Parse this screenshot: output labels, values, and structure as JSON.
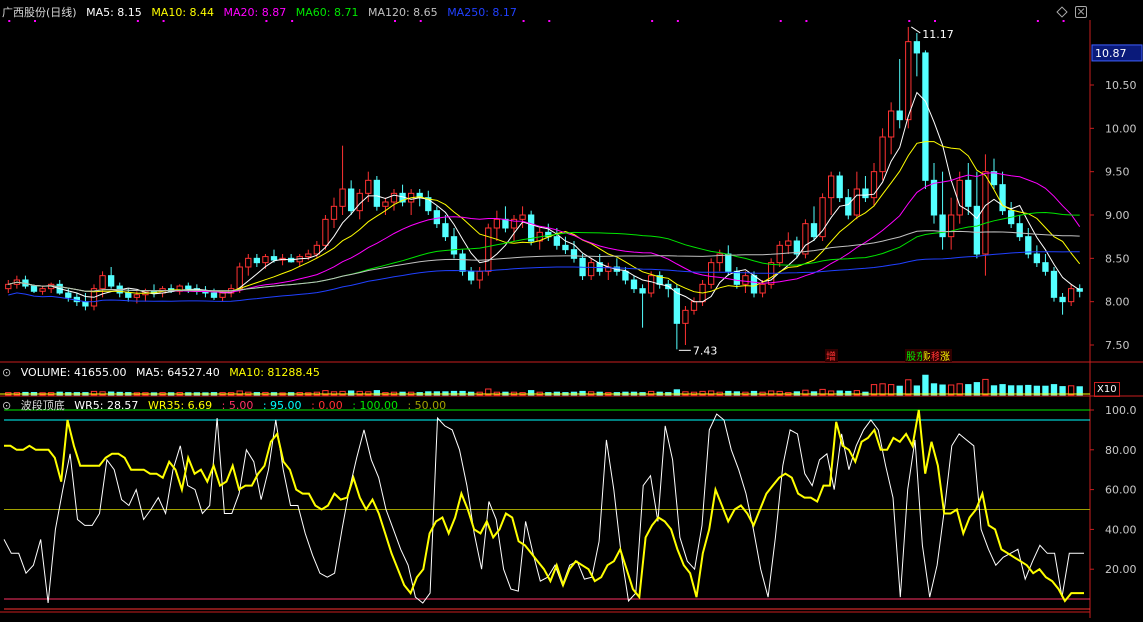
{
  "colors": {
    "up": "#ff3232",
    "down": "#54ffff",
    "ma5": "#ffffff",
    "ma10": "#ffff00",
    "ma20": "#ff00ff",
    "ma60": "#00e600",
    "ma120": "#c0c0c0",
    "ma250": "#2040ff",
    "axis": "#c81e1e",
    "wr5": "#ffffff",
    "wr35": "#ffff00",
    "level5": "#ff3264",
    "level95": "#00ffff",
    "level0": "#ff3232",
    "level100": "#00e600",
    "level50": "#a0a000"
  },
  "price_panel": {
    "title": "广西股份(日线)",
    "indicators": [
      {
        "key": "ma5",
        "label": "MA5: 8.15"
      },
      {
        "key": "ma10",
        "label": "MA10: 8.44"
      },
      {
        "key": "ma20",
        "label": "MA20: 8.87"
      },
      {
        "key": "ma60",
        "label": "MA60: 8.71"
      },
      {
        "key": "ma120",
        "label": "MA120: 8.65"
      },
      {
        "key": "ma250",
        "label": "MA250: 8.17"
      }
    ],
    "current_price": "10.87",
    "high_label": "11.17",
    "low_label": "7.43",
    "ticks": [
      "10.50",
      "10.00",
      "9.50",
      "9.00",
      "8.50",
      "8.00",
      "7.50"
    ],
    "tags": [
      {
        "text": "增",
        "color": "#ff3232"
      },
      {
        "text": "股东",
        "color": "#00e600"
      },
      {
        "text": "财报",
        "color": "#ffff00"
      },
      {
        "text": "移",
        "color": "#ff3232"
      },
      {
        "text": "涨",
        "color": "#ffff00"
      }
    ]
  },
  "volume_panel": {
    "labels": [
      "VOLUME: 41655.00",
      "MA5: 64527.40",
      "MA10: 81288.45"
    ],
    "unit": "X10"
  },
  "wr_panel": {
    "title": "波段顶底",
    "labels": [
      "WR5: 28.57",
      "WR35: 6.69",
      ": 5.00",
      ": 95.00",
      ": 0.00",
      ": 100.00",
      ": 50.00"
    ],
    "ticks": [
      "100.0",
      "80.00",
      "60.00",
      "40.00",
      "20.00"
    ]
  },
  "chart_data": {
    "type": "candlestick",
    "y_range": [
      7.35,
      11.25
    ],
    "candles": [
      [
        8.15,
        8.25,
        8.1,
        8.2
      ],
      [
        8.2,
        8.3,
        8.15,
        8.25
      ],
      [
        8.25,
        8.3,
        8.15,
        8.18
      ],
      [
        8.18,
        8.2,
        8.1,
        8.12
      ],
      [
        8.12,
        8.18,
        8.08,
        8.15
      ],
      [
        8.15,
        8.22,
        8.1,
        8.2
      ],
      [
        8.2,
        8.25,
        8.08,
        8.1
      ],
      [
        8.1,
        8.15,
        8.0,
        8.05
      ],
      [
        8.05,
        8.1,
        7.95,
        8.0
      ],
      [
        8.0,
        8.1,
        7.9,
        7.95
      ],
      [
        7.95,
        8.2,
        7.9,
        8.15
      ],
      [
        8.15,
        8.35,
        8.05,
        8.3
      ],
      [
        8.3,
        8.4,
        8.15,
        8.18
      ],
      [
        8.18,
        8.22,
        8.05,
        8.1
      ],
      [
        8.1,
        8.15,
        8.0,
        8.05
      ],
      [
        8.05,
        8.12,
        7.98,
        8.08
      ],
      [
        8.08,
        8.15,
        8.0,
        8.12
      ],
      [
        8.12,
        8.2,
        8.05,
        8.1
      ],
      [
        8.1,
        8.18,
        8.05,
        8.15
      ],
      [
        8.15,
        8.2,
        8.1,
        8.12
      ],
      [
        8.12,
        8.2,
        8.08,
        8.18
      ],
      [
        8.18,
        8.22,
        8.1,
        8.15
      ],
      [
        8.15,
        8.2,
        8.08,
        8.12
      ],
      [
        8.12,
        8.18,
        8.05,
        8.1
      ],
      [
        8.1,
        8.15,
        8.02,
        8.05
      ],
      [
        8.05,
        8.12,
        8.0,
        8.1
      ],
      [
        8.1,
        8.2,
        8.05,
        8.15
      ],
      [
        8.15,
        8.45,
        8.1,
        8.4
      ],
      [
        8.4,
        8.55,
        8.3,
        8.5
      ],
      [
        8.5,
        8.55,
        8.4,
        8.45
      ],
      [
        8.45,
        8.55,
        8.38,
        8.52
      ],
      [
        8.52,
        8.6,
        8.45,
        8.48
      ],
      [
        8.48,
        8.55,
        8.42,
        8.5
      ],
      [
        8.5,
        8.55,
        8.45,
        8.46
      ],
      [
        8.46,
        8.55,
        8.4,
        8.52
      ],
      [
        8.52,
        8.6,
        8.48,
        8.55
      ],
      [
        8.55,
        8.7,
        8.5,
        8.65
      ],
      [
        8.65,
        9.0,
        8.6,
        8.95
      ],
      [
        8.95,
        9.2,
        8.85,
        9.1
      ],
      [
        9.1,
        9.8,
        9.0,
        9.3
      ],
      [
        9.3,
        9.4,
        9.0,
        9.05
      ],
      [
        9.05,
        9.3,
        8.95,
        9.25
      ],
      [
        9.25,
        9.5,
        9.15,
        9.4
      ],
      [
        9.4,
        9.45,
        9.05,
        9.1
      ],
      [
        9.1,
        9.2,
        9.0,
        9.15
      ],
      [
        9.15,
        9.3,
        9.05,
        9.25
      ],
      [
        9.25,
        9.35,
        9.1,
        9.15
      ],
      [
        9.15,
        9.3,
        9.0,
        9.25
      ],
      [
        9.25,
        9.3,
        9.1,
        9.2
      ],
      [
        9.2,
        9.28,
        9.0,
        9.05
      ],
      [
        9.05,
        9.1,
        8.85,
        8.9
      ],
      [
        8.9,
        9.0,
        8.7,
        8.75
      ],
      [
        8.75,
        8.85,
        8.5,
        8.55
      ],
      [
        8.55,
        8.6,
        8.3,
        8.35
      ],
      [
        8.35,
        8.4,
        8.2,
        8.25
      ],
      [
        8.25,
        8.4,
        8.15,
        8.35
      ],
      [
        8.35,
        8.9,
        8.3,
        8.85
      ],
      [
        8.85,
        9.05,
        8.7,
        8.95
      ],
      [
        8.95,
        9.1,
        8.8,
        8.85
      ],
      [
        8.85,
        9.0,
        8.7,
        8.95
      ],
      [
        8.95,
        9.1,
        8.85,
        9.0
      ],
      [
        9.0,
        9.05,
        8.65,
        8.7
      ],
      [
        8.7,
        8.85,
        8.6,
        8.8
      ],
      [
        8.8,
        8.9,
        8.7,
        8.75
      ],
      [
        8.75,
        8.85,
        8.6,
        8.65
      ],
      [
        8.65,
        8.75,
        8.55,
        8.6
      ],
      [
        8.6,
        8.7,
        8.45,
        8.5
      ],
      [
        8.5,
        8.55,
        8.25,
        8.3
      ],
      [
        8.3,
        8.5,
        8.25,
        8.45
      ],
      [
        8.45,
        8.55,
        8.3,
        8.35
      ],
      [
        8.35,
        8.45,
        8.25,
        8.4
      ],
      [
        8.4,
        8.5,
        8.3,
        8.35
      ],
      [
        8.35,
        8.4,
        8.2,
        8.25
      ],
      [
        8.25,
        8.3,
        8.1,
        8.15
      ],
      [
        8.15,
        8.2,
        7.7,
        8.1
      ],
      [
        8.1,
        8.35,
        8.05,
        8.3
      ],
      [
        8.3,
        8.35,
        8.15,
        8.2
      ],
      [
        8.2,
        8.25,
        8.05,
        8.15
      ],
      [
        8.15,
        8.2,
        7.45,
        7.75
      ],
      [
        7.75,
        7.95,
        7.5,
        7.9
      ],
      [
        7.9,
        8.05,
        7.85,
        8.0
      ],
      [
        8.0,
        8.25,
        7.95,
        8.2
      ],
      [
        8.2,
        8.5,
        8.15,
        8.45
      ],
      [
        8.45,
        8.6,
        8.35,
        8.55
      ],
      [
        8.55,
        8.65,
        8.3,
        8.35
      ],
      [
        8.35,
        8.4,
        8.15,
        8.2
      ],
      [
        8.2,
        8.35,
        8.1,
        8.3
      ],
      [
        8.3,
        8.35,
        8.05,
        8.1
      ],
      [
        8.1,
        8.25,
        8.05,
        8.2
      ],
      [
        8.2,
        8.5,
        8.15,
        8.45
      ],
      [
        8.45,
        8.7,
        8.4,
        8.65
      ],
      [
        8.65,
        8.8,
        8.55,
        8.7
      ],
      [
        8.7,
        8.75,
        8.5,
        8.55
      ],
      [
        8.55,
        8.95,
        8.5,
        8.9
      ],
      [
        8.9,
        9.1,
        8.7,
        8.75
      ],
      [
        8.75,
        9.25,
        8.7,
        9.2
      ],
      [
        9.2,
        9.5,
        9.0,
        9.45
      ],
      [
        9.45,
        9.5,
        9.15,
        9.2
      ],
      [
        9.2,
        9.3,
        8.95,
        9.0
      ],
      [
        9.0,
        9.5,
        8.95,
        9.3
      ],
      [
        9.3,
        9.45,
        9.15,
        9.2
      ],
      [
        9.2,
        9.6,
        9.1,
        9.5
      ],
      [
        9.5,
        10.0,
        9.4,
        9.9
      ],
      [
        9.9,
        10.3,
        9.7,
        10.2
      ],
      [
        10.2,
        10.8,
        10.0,
        10.1
      ],
      [
        10.1,
        11.17,
        10.0,
        11.0
      ],
      [
        11.0,
        11.1,
        10.6,
        10.87
      ],
      [
        10.87,
        10.9,
        9.3,
        9.4
      ],
      [
        9.4,
        9.6,
        8.9,
        9.0
      ],
      [
        9.0,
        9.5,
        8.6,
        8.75
      ],
      [
        8.75,
        9.2,
        8.6,
        9.0
      ],
      [
        9.0,
        9.5,
        8.9,
        9.4
      ],
      [
        9.4,
        9.6,
        9.0,
        9.1
      ],
      [
        9.1,
        9.5,
        8.5,
        8.55
      ],
      [
        8.55,
        9.7,
        8.3,
        9.5
      ],
      [
        9.5,
        9.65,
        9.3,
        9.35
      ],
      [
        9.35,
        9.5,
        9.0,
        9.05
      ],
      [
        9.05,
        9.15,
        8.85,
        8.9
      ],
      [
        8.9,
        9.0,
        8.7,
        8.75
      ],
      [
        8.75,
        8.85,
        8.5,
        8.55
      ],
      [
        8.55,
        8.65,
        8.4,
        8.45
      ],
      [
        8.45,
        8.55,
        8.3,
        8.35
      ],
      [
        8.35,
        8.4,
        8.0,
        8.05
      ],
      [
        8.05,
        8.1,
        7.85,
        8.0
      ],
      [
        8.0,
        8.2,
        7.95,
        8.15
      ],
      [
        8.15,
        8.2,
        8.05,
        8.12
      ]
    ],
    "wr5": [
      35,
      28,
      28,
      18,
      22,
      35,
      3,
      40,
      60,
      78,
      45,
      42,
      42,
      48,
      75,
      70,
      55,
      52,
      60,
      45,
      50,
      56,
      48,
      70,
      82,
      62,
      60,
      48,
      52,
      96,
      48,
      48,
      58,
      80,
      74,
      55,
      70,
      95,
      70,
      52,
      52,
      38,
      27,
      18,
      16,
      18,
      40,
      60,
      76,
      90,
      75,
      66,
      50,
      40,
      30,
      22,
      6,
      3,
      8,
      96,
      92,
      90,
      80,
      62,
      38,
      20,
      54,
      45,
      20,
      10,
      9,
      44,
      28,
      14,
      16,
      22,
      12,
      22,
      24,
      15,
      16,
      34,
      85,
      60,
      28,
      4,
      8,
      62,
      67,
      44,
      92,
      75,
      36,
      24,
      20,
      42,
      90,
      98,
      95,
      80,
      70,
      58,
      40,
      20,
      6,
      36,
      72,
      90,
      88,
      68,
      62,
      75,
      78,
      60,
      88,
      70,
      82,
      90,
      95,
      90,
      72,
      56,
      6,
      60,
      85,
      32,
      6,
      22,
      50,
      82,
      88,
      85,
      82,
      40,
      30,
      22,
      26,
      28,
      30,
      15,
      24,
      32,
      28,
      28,
      6,
      28,
      28,
      28
    ],
    "wr35": [
      82,
      82,
      80,
      80,
      82,
      80,
      80,
      80,
      76,
      64,
      95,
      82,
      72,
      72,
      72,
      72,
      76,
      78,
      78,
      76,
      70,
      70,
      70,
      68,
      68,
      66,
      74,
      70,
      60,
      76,
      68,
      70,
      64,
      72,
      62,
      64,
      72,
      60,
      62,
      62,
      68,
      72,
      84,
      88,
      74,
      70,
      60,
      58,
      58,
      52,
      50,
      52,
      58,
      55,
      56,
      66,
      56,
      50,
      55,
      48,
      38,
      28,
      20,
      12,
      8,
      16,
      20,
      38,
      44,
      46,
      38,
      46,
      58,
      50,
      40,
      38,
      44,
      36,
      40,
      48,
      46,
      34,
      32,
      28,
      24,
      20,
      14,
      22,
      12,
      20,
      24,
      22,
      20,
      14,
      16,
      22,
      24,
      30,
      20,
      10,
      6,
      36,
      42,
      46,
      44,
      40,
      30,
      22,
      18,
      6,
      28,
      40,
      60,
      52,
      44,
      50,
      52,
      48,
      42,
      50,
      58,
      62,
      66,
      68,
      66,
      58,
      56,
      56,
      54,
      62,
      62,
      94,
      82,
      80,
      74,
      84,
      86,
      90,
      80,
      80,
      86,
      84,
      88,
      82,
      100,
      68,
      84,
      72,
      48,
      48,
      50,
      38,
      46,
      50,
      58,
      42,
      40,
      30,
      28,
      26,
      24,
      22,
      18,
      20,
      16,
      14,
      10,
      4,
      8,
      8,
      8
    ]
  }
}
